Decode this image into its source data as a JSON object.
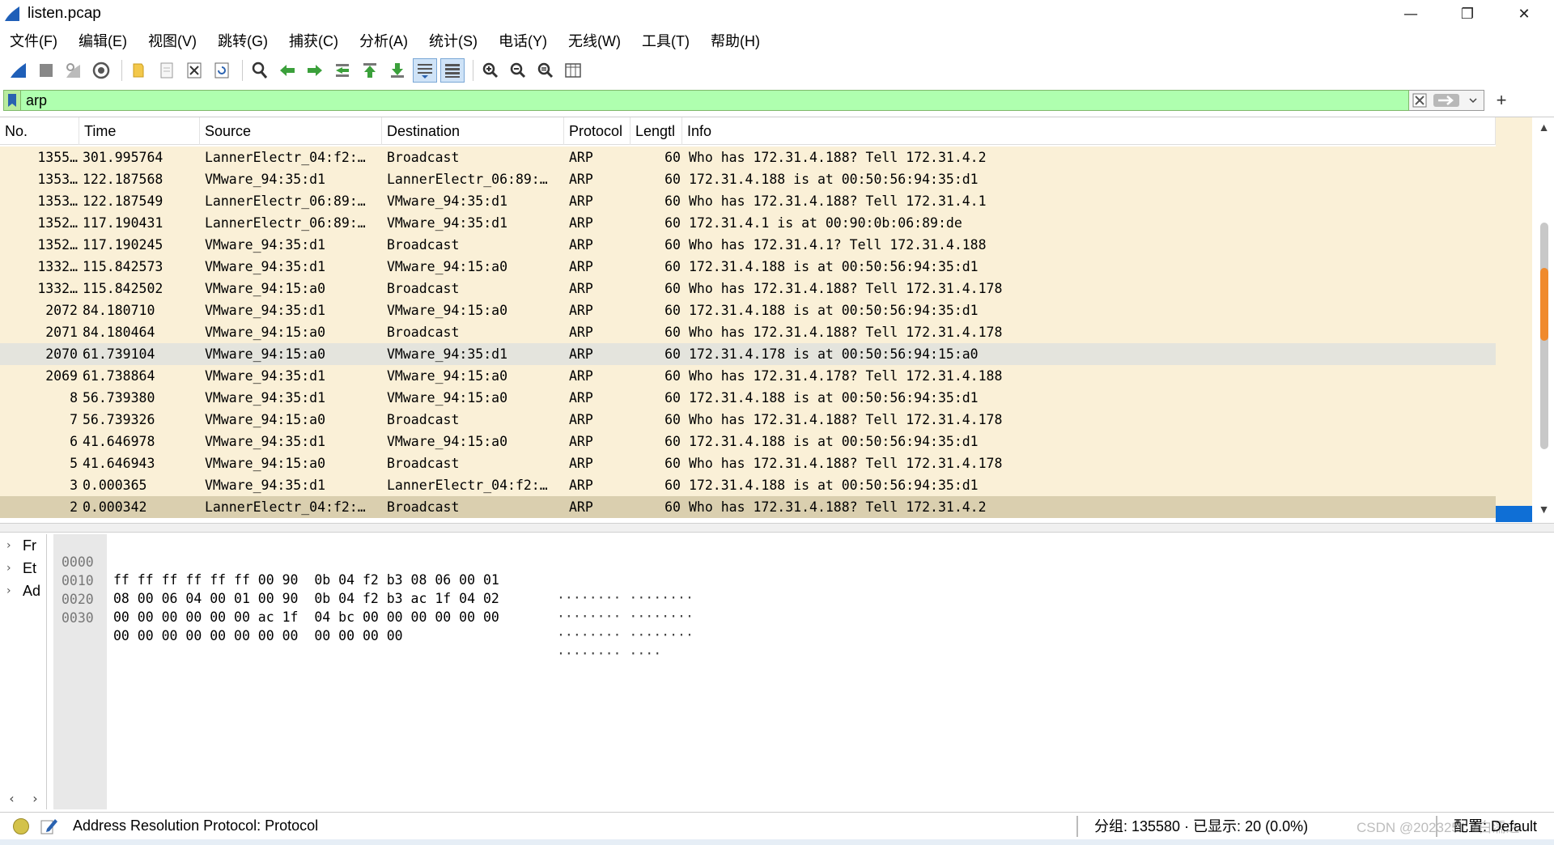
{
  "window": {
    "title": "listen.pcap",
    "minimize": "—",
    "restore": "❐",
    "close": "✕"
  },
  "menu": [
    "文件(F)",
    "编辑(E)",
    "视图(V)",
    "跳转(G)",
    "捕获(C)",
    "分析(A)",
    "统计(S)",
    "电话(Y)",
    "无线(W)",
    "工具(T)",
    "帮助(H)"
  ],
  "toolbar": {
    "icons": [
      "shark-fin-start-icon",
      "stop-square-icon",
      "restart-fin-icon",
      "capture-options-gear-icon",
      "open-folder-icon",
      "file-icon",
      "close-file-icon",
      "reload-icon",
      "find-icon",
      "back-arrow-icon",
      "forward-arrow-icon",
      "goto-packet-icon",
      "first-packet-icon",
      "last-packet-icon",
      "autoscroll-icon",
      "colorize-icon",
      "zoom-in-icon",
      "zoom-out-icon",
      "zoom-normal-icon",
      "resize-columns-icon"
    ],
    "colors": {
      "shark": "#1f5fb8",
      "arrow": "#3ba03b"
    }
  },
  "filter": {
    "value": "arp",
    "background": "#afffaf",
    "add_button": "+"
  },
  "packet_list": {
    "columns": [
      "No.",
      "Time",
      "Source",
      "Destination",
      "Protocol",
      "Lengtl",
      "Info"
    ],
    "rows": [
      {
        "no": "1355…",
        "time": "301.995764",
        "src": "LannerElectr_04:f2:…",
        "dst": "Broadcast",
        "proto": "ARP",
        "len": "60",
        "info": "Who has 172.31.4.188? Tell 172.31.4.2"
      },
      {
        "no": "1353…",
        "time": "122.187568",
        "src": "VMware_94:35:d1",
        "dst": "LannerElectr_06:89:…",
        "proto": "ARP",
        "len": "60",
        "info": "172.31.4.188 is at 00:50:56:94:35:d1"
      },
      {
        "no": "1353…",
        "time": "122.187549",
        "src": "LannerElectr_06:89:…",
        "dst": "VMware_94:35:d1",
        "proto": "ARP",
        "len": "60",
        "info": "Who has 172.31.4.188? Tell 172.31.4.1"
      },
      {
        "no": "1352…",
        "time": "117.190431",
        "src": "LannerElectr_06:89:…",
        "dst": "VMware_94:35:d1",
        "proto": "ARP",
        "len": "60",
        "info": "172.31.4.1 is at 00:90:0b:06:89:de"
      },
      {
        "no": "1352…",
        "time": "117.190245",
        "src": "VMware_94:35:d1",
        "dst": "Broadcast",
        "proto": "ARP",
        "len": "60",
        "info": "Who has 172.31.4.1? Tell 172.31.4.188"
      },
      {
        "no": "1332…",
        "time": "115.842573",
        "src": "VMware_94:35:d1",
        "dst": "VMware_94:15:a0",
        "proto": "ARP",
        "len": "60",
        "info": "172.31.4.188 is at 00:50:56:94:35:d1"
      },
      {
        "no": "1332…",
        "time": "115.842502",
        "src": "VMware_94:15:a0",
        "dst": "Broadcast",
        "proto": "ARP",
        "len": "60",
        "info": "Who has 172.31.4.188? Tell 172.31.4.178"
      },
      {
        "no": "2072",
        "time": "84.180710",
        "src": "VMware_94:35:d1",
        "dst": "VMware_94:15:a0",
        "proto": "ARP",
        "len": "60",
        "info": "172.31.4.188 is at 00:50:56:94:35:d1"
      },
      {
        "no": "2071",
        "time": "84.180464",
        "src": "VMware_94:15:a0",
        "dst": "Broadcast",
        "proto": "ARP",
        "len": "60",
        "info": "Who has 172.31.4.188? Tell 172.31.4.178"
      },
      {
        "no": "2070",
        "time": "61.739104",
        "src": "VMware_94:15:a0",
        "dst": "VMware_94:35:d1",
        "proto": "ARP",
        "len": "60",
        "info": "172.31.4.178 is at 00:50:56:94:15:a0",
        "alt": true
      },
      {
        "no": "2069",
        "time": "61.738864",
        "src": "VMware_94:35:d1",
        "dst": "VMware_94:15:a0",
        "proto": "ARP",
        "len": "60",
        "info": "Who has 172.31.4.178? Tell 172.31.4.188"
      },
      {
        "no": "8",
        "time": "56.739380",
        "src": "VMware_94:35:d1",
        "dst": "VMware_94:15:a0",
        "proto": "ARP",
        "len": "60",
        "info": "172.31.4.188 is at 00:50:56:94:35:d1"
      },
      {
        "no": "7",
        "time": "56.739326",
        "src": "VMware_94:15:a0",
        "dst": "Broadcast",
        "proto": "ARP",
        "len": "60",
        "info": "Who has 172.31.4.188? Tell 172.31.4.178"
      },
      {
        "no": "6",
        "time": "41.646978",
        "src": "VMware_94:35:d1",
        "dst": "VMware_94:15:a0",
        "proto": "ARP",
        "len": "60",
        "info": "172.31.4.188 is at 00:50:56:94:35:d1"
      },
      {
        "no": "5",
        "time": "41.646943",
        "src": "VMware_94:15:a0",
        "dst": "Broadcast",
        "proto": "ARP",
        "len": "60",
        "info": "Who has 172.31.4.188? Tell 172.31.4.178"
      },
      {
        "no": "3",
        "time": "0.000365",
        "src": "VMware_94:35:d1",
        "dst": "LannerElectr_04:f2:…",
        "proto": "ARP",
        "len": "60",
        "info": "172.31.4.188 is at 00:50:56:94:35:d1"
      },
      {
        "no": "2",
        "time": "0.000342",
        "src": "LannerElectr_04:f2:…",
        "dst": "Broadcast",
        "proto": "ARP",
        "len": "60",
        "info": "Who has 172.31.4.188? Tell 172.31.4.2",
        "selected": true
      }
    ],
    "row_color": "#faf0d7",
    "selected_color": "#dacfaf",
    "scroll_up": "▲",
    "scroll_down": "▼"
  },
  "details": {
    "items": [
      "Fr",
      "Et",
      "Ad"
    ],
    "expander": "›",
    "hscroll_left": "‹",
    "hscroll_right": "›"
  },
  "bytes": {
    "rows": [
      {
        "offset": "0000",
        "hex": "ff ff ff ff ff ff 00 90  0b 04 f2 b3 08 06 00 01",
        "ascii": "········ ········"
      },
      {
        "offset": "0010",
        "hex": "08 00 06 04 00 01 00 90  0b 04 f2 b3 ac 1f 04 02",
        "ascii": "········ ········"
      },
      {
        "offset": "0020",
        "hex": "00 00 00 00 00 00 ac 1f  04 bc 00 00 00 00 00 00",
        "ascii": "········ ········"
      },
      {
        "offset": "0030",
        "hex": "00 00 00 00 00 00 00 00  00 00 00 00",
        "ascii": "········ ····"
      }
    ]
  },
  "status": {
    "led_color": "#d3c24a",
    "message": "Address Resolution Protocol: Protocol",
    "packets": "分组: 135580 · 已显示: 20 (0.0%)",
    "profile": "配置: Default",
    "watermark": "CSDN @2023251 7白濡之"
  }
}
